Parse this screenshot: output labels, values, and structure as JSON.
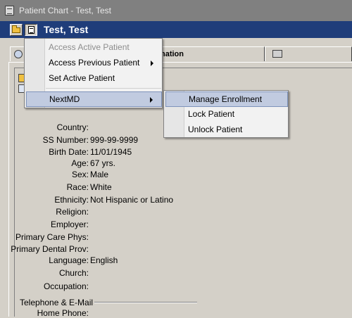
{
  "window": {
    "title": "Patient Chart - Test, Test"
  },
  "header": {
    "patient_name": "Test, Test"
  },
  "tabs": [
    {
      "label": "nation"
    }
  ],
  "menu": {
    "items": [
      {
        "label": "Access Active Patient",
        "disabled": true
      },
      {
        "label": "Access Previous Patient",
        "submenu": true
      },
      {
        "label": "Set Active Patient"
      },
      {
        "label": "NextMD",
        "submenu": true,
        "highlighted": true
      }
    ]
  },
  "submenu": {
    "items": [
      {
        "label": "Manage Enrollment",
        "highlighted": true
      },
      {
        "label": "Lock Patient"
      },
      {
        "label": "Unlock Patient"
      }
    ]
  },
  "demographics": [
    {
      "label": "Country:",
      "value": ""
    },
    {
      "label": "SS Number:",
      "value": "999-99-9999"
    },
    {
      "label": "Birth Date:",
      "value": "11/01/1945"
    },
    {
      "label": "Age:",
      "value": "67 yrs."
    },
    {
      "label": "Sex:",
      "value": "Male"
    },
    {
      "label": "Race:",
      "value": "White"
    },
    {
      "label": "Ethnicity:",
      "value": "Not Hispanic or Latino"
    },
    {
      "label": "Religion:",
      "value": ""
    },
    {
      "label": "Employer:",
      "value": ""
    },
    {
      "label": "Primary Care Phys:",
      "value": ""
    },
    {
      "label": "Primary Dental Prov:",
      "value": ""
    },
    {
      "label": "Language:",
      "value": "English"
    },
    {
      "label": "Church:",
      "value": ""
    },
    {
      "label": "Occupation:",
      "value": ""
    }
  ],
  "contact_section": {
    "title": "Telephone & E-Mail"
  },
  "contact": [
    {
      "label": "Home Phone:",
      "value": ""
    }
  ]
}
